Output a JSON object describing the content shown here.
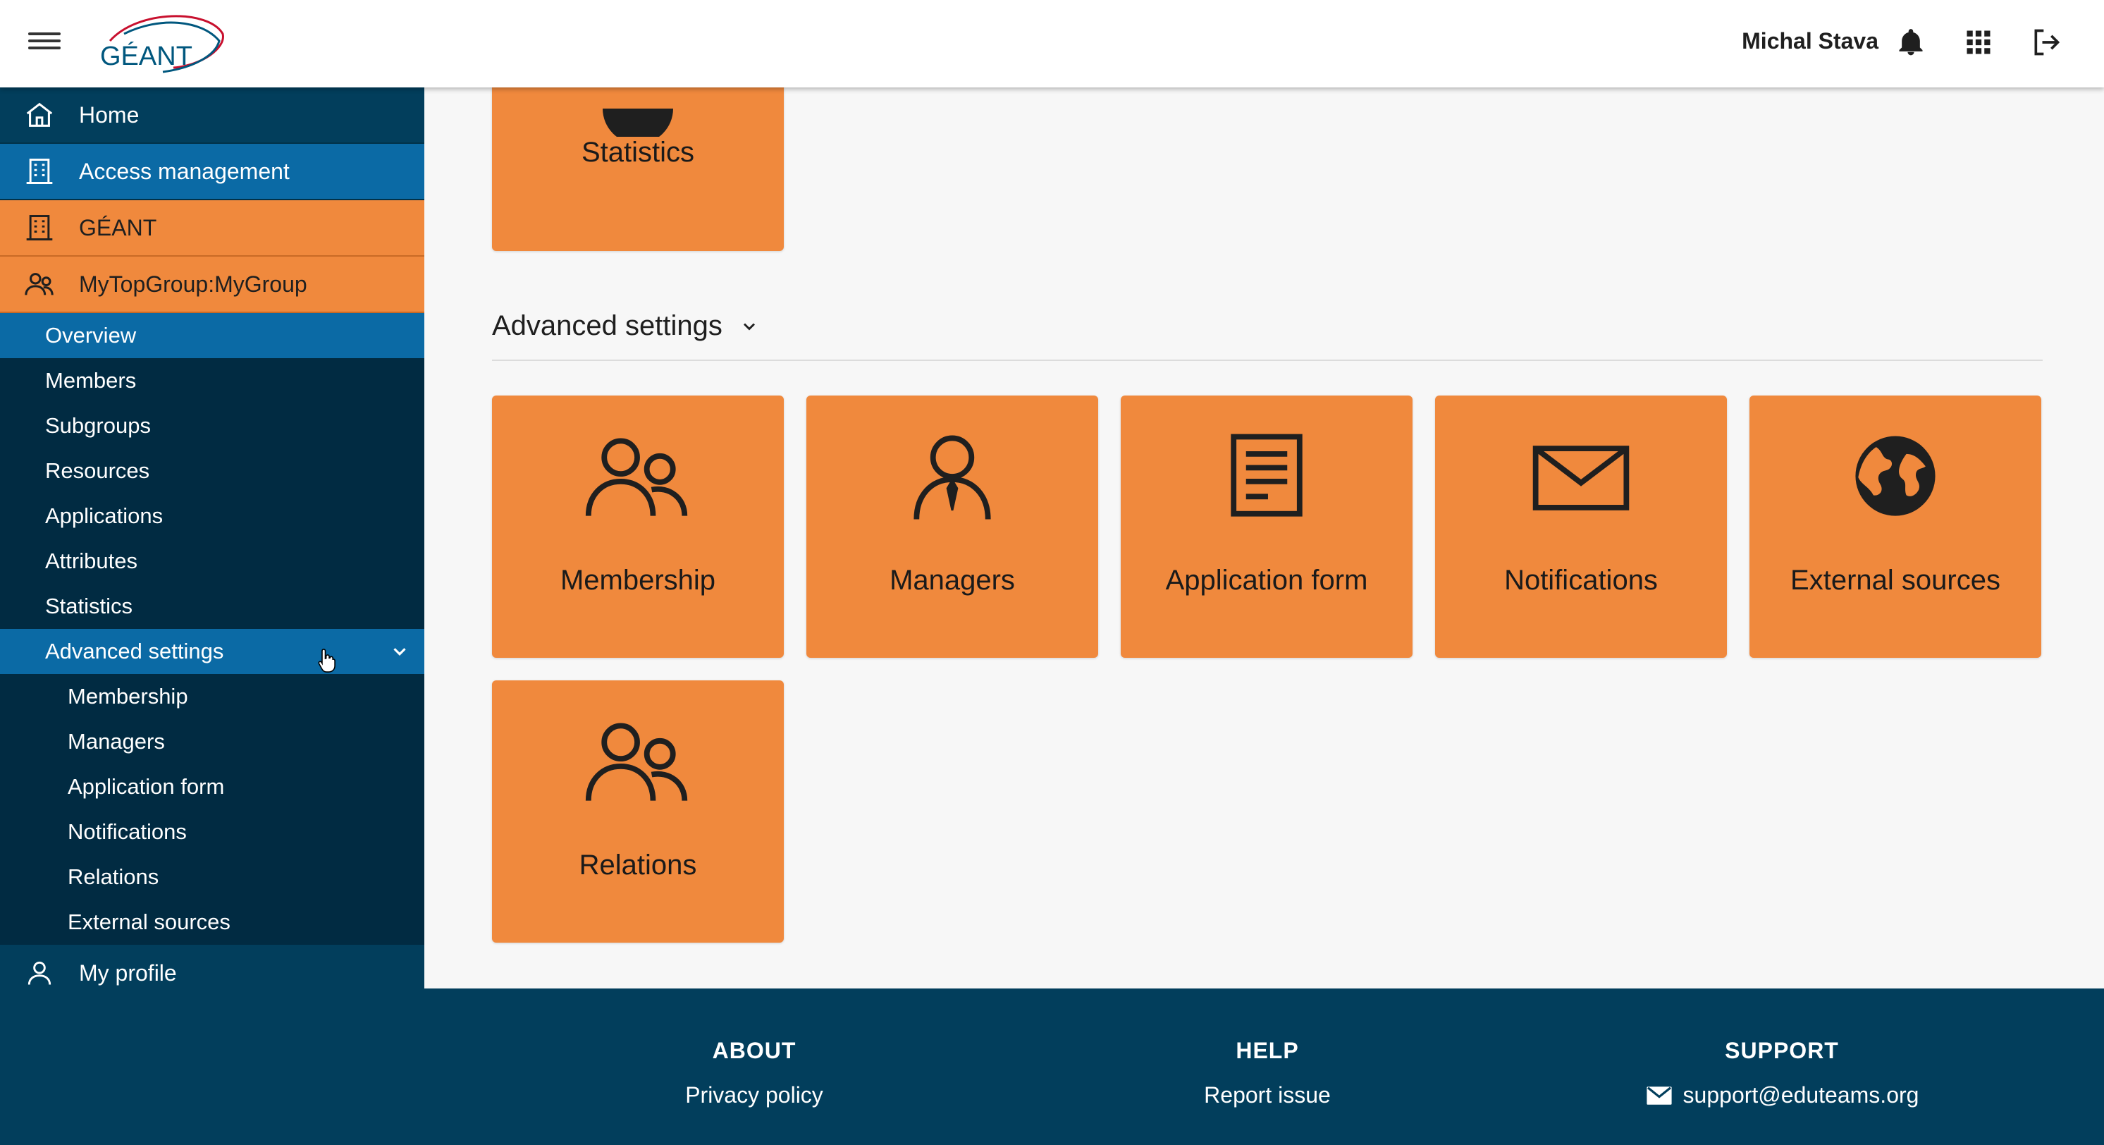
{
  "header": {
    "logo_text": "GÉANT",
    "user_name": "Michal Stava"
  },
  "sidebar": {
    "top_items": [
      {
        "label": "Home",
        "icon": "home-icon"
      },
      {
        "label": "Access management",
        "icon": "building-icon"
      },
      {
        "label": "GÉANT",
        "icon": "building-icon"
      },
      {
        "label": "MyTopGroup:MyGroup",
        "icon": "group-icon"
      }
    ],
    "group_items": [
      {
        "label": "Overview",
        "state": "active"
      },
      {
        "label": "Members"
      },
      {
        "label": "Subgroups"
      },
      {
        "label": "Resources"
      },
      {
        "label": "Applications"
      },
      {
        "label": "Attributes"
      },
      {
        "label": "Statistics"
      },
      {
        "label": "Advanced settings",
        "state": "expanded"
      }
    ],
    "advanced_items": [
      {
        "label": "Membership"
      },
      {
        "label": "Managers"
      },
      {
        "label": "Application form"
      },
      {
        "label": "Notifications"
      },
      {
        "label": "Relations"
      },
      {
        "label": "External sources"
      }
    ],
    "profile_label": "My profile"
  },
  "main": {
    "stats_tile_label": "Statistics",
    "section_title": "Advanced settings",
    "tiles": [
      {
        "label": "Membership",
        "icon": "group-icon"
      },
      {
        "label": "Managers",
        "icon": "manager-icon"
      },
      {
        "label": "Application form",
        "icon": "document-icon"
      },
      {
        "label": "Notifications",
        "icon": "envelope-icon"
      },
      {
        "label": "External sources",
        "icon": "globe-icon"
      },
      {
        "label": "Relations",
        "icon": "group-icon"
      }
    ]
  },
  "footer": {
    "about_heading": "ABOUT",
    "about_link": "Privacy policy",
    "help_heading": "HELP",
    "help_link": "Report issue",
    "support_heading": "SUPPORT",
    "support_email": "support@eduteams.org"
  },
  "colors": {
    "sidebar_bg": "#023e5c",
    "accent_blue": "#0b6aa5",
    "tile_orange": "#f0893d"
  }
}
